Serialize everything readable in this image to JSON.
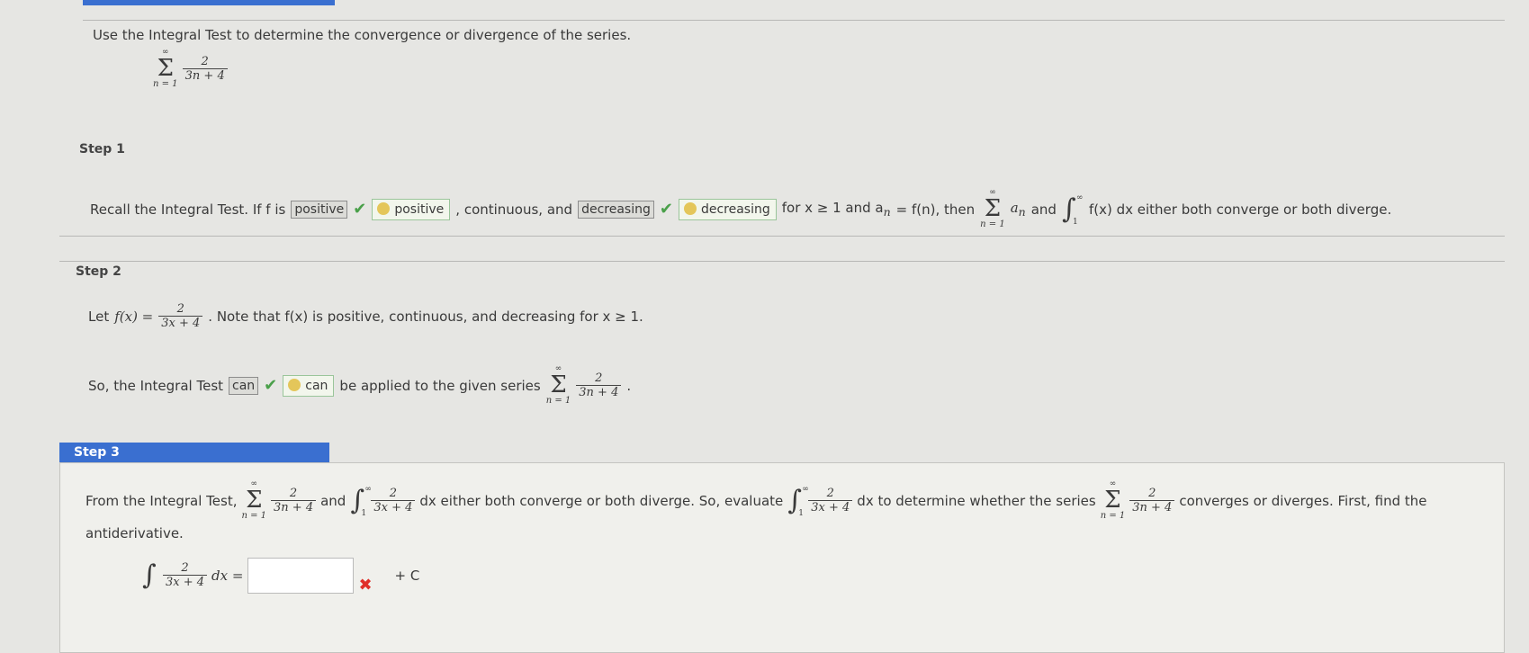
{
  "problem": {
    "instruction": "Use the Integral Test to determine the convergence or divergence of the series.",
    "series": {
      "upper": "∞",
      "lower": "n = 1",
      "num": "2",
      "den": "3n + 4"
    }
  },
  "step1": {
    "label": "Step 1",
    "text_a": "Recall the Integral Test. If f is",
    "box1": "positive",
    "green1": "positive",
    "text_b": ", continuous, and",
    "box2": "decreasing",
    "green2": "decreasing",
    "text_c": "for x ≥ 1 and a",
    "sub_n": "n",
    "text_d": "= f(n), then",
    "sigma_upper": "∞",
    "sigma_lower": "n = 1",
    "a_n": "a",
    "text_and": "and",
    "int_upper": "∞",
    "int_lower": "1",
    "text_e": "f(x) dx  either both converge or both diverge."
  },
  "step2": {
    "label": "Step 2",
    "let": "Let",
    "fx": "f(x) =",
    "num": "2",
    "den": "3x + 4",
    "note": ". Note that f(x) is positive, continuous, and decreasing for x ≥ 1.",
    "so": "So, the Integral Test",
    "box": "can",
    "green": "can",
    "applied": "be applied to the given series",
    "series_upper": "∞",
    "series_lower": "n = 1",
    "series_num": "2",
    "series_den": "3n + 4",
    "period": "."
  },
  "step3": {
    "label": "Step 3",
    "from": "From the Integral Test,",
    "s1_upper": "∞",
    "s1_lower": "n = 1",
    "s1_num": "2",
    "s1_den": "3n + 4",
    "and": "and",
    "i1_upper": "∞",
    "i1_lower": "1",
    "i1_num": "2",
    "i1_den": "3x + 4",
    "mid": "dx  either both converge or both diverge. So, evaluate",
    "i2_upper": "∞",
    "i2_lower": "1",
    "i2_num": "2",
    "i2_den": "3x + 4",
    "mid2": "dx  to determine whether the series",
    "s2_upper": "∞",
    "s2_lower": "n = 1",
    "s2_num": "2",
    "s2_den": "3n + 4",
    "end": "converges or diverges. First, find the",
    "antideriv": "antiderivative.",
    "int_num": "2",
    "int_den": "3x + 4",
    "dx_eq": "dx =",
    "plus_c": "+ C",
    "answer_value": ""
  },
  "colors": {
    "accent": "#3a6fd0",
    "check": "#4aa04a",
    "cross": "#e0302a"
  },
  "icons": [
    "checkmark-icon",
    "pencil-icon",
    "cross-icon"
  ]
}
